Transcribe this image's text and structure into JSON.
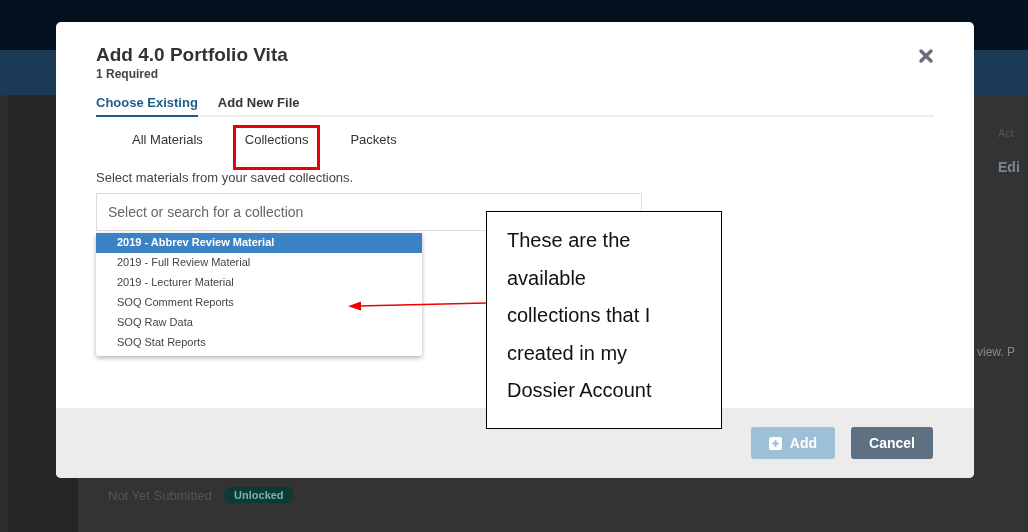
{
  "page": {
    "column_header": "Act",
    "action_link": "Edi",
    "row_text": "view. P",
    "item_status": "Not Yet Submitted",
    "item_badge": "Unlocked"
  },
  "dialog": {
    "title": "Add 4.0 Portfolio Vita",
    "subtitle": "1 Required",
    "tabs": [
      {
        "label": "Choose Existing",
        "selected": true
      },
      {
        "label": "Add New File",
        "selected": false
      }
    ],
    "subtabs": [
      {
        "label": "All Materials",
        "selected": false
      },
      {
        "label": "Collections",
        "selected": true
      },
      {
        "label": "Packets",
        "selected": false
      }
    ],
    "instructions": "Select materials from your saved collections.",
    "search": {
      "placeholder": "Select or search for a collection"
    },
    "options": [
      {
        "label": "2019 - Abbrev Review Material",
        "selected": true
      },
      {
        "label": "2019 - Full Review Material",
        "selected": false
      },
      {
        "label": "2019 - Lecturer Material",
        "selected": false
      },
      {
        "label": "SOQ Comment Reports",
        "selected": false
      },
      {
        "label": "SOQ Raw Data",
        "selected": false
      },
      {
        "label": "SOQ Stat Reports",
        "selected": false
      }
    ],
    "buttons": [
      {
        "label": "Add",
        "kind": "primary",
        "disabled": true
      },
      {
        "label": "Cancel",
        "kind": "secondary",
        "disabled": false
      }
    ]
  },
  "annotation": {
    "text": "These are the available collections that I created in my Dossier Account"
  }
}
